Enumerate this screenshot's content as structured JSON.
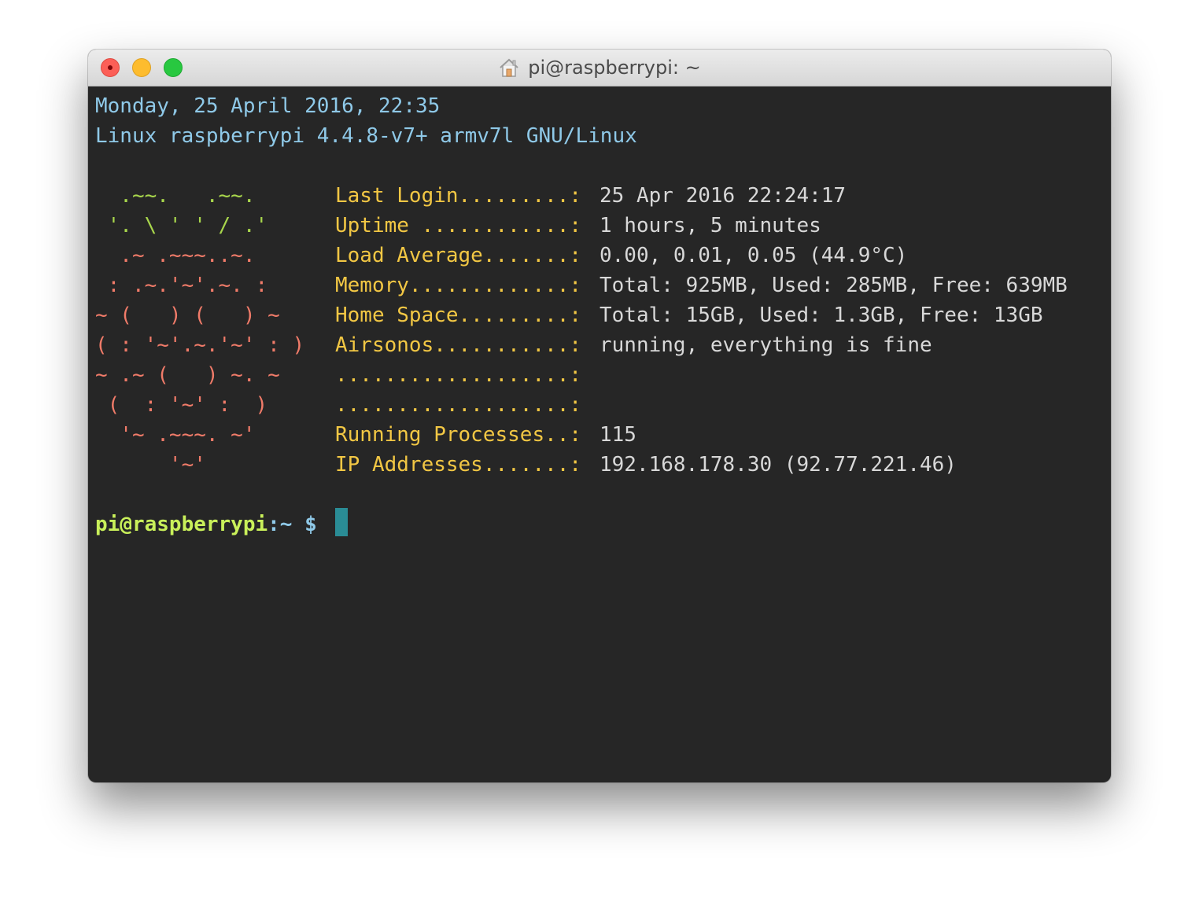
{
  "window": {
    "title": "pi@raspberrypi: ~",
    "title_icon": "home-icon",
    "traffic_lights": [
      "close",
      "minimize",
      "zoom"
    ]
  },
  "colors": {
    "background": "#262626",
    "header_blue": "#8fc9e8",
    "ascii_green": "#a8d64c",
    "ascii_red": "#f07b69",
    "label_yellow": "#f2c744",
    "value_grey": "#d8d8d8",
    "prompt_green": "#c9f05a",
    "cursor": "#2a8c95"
  },
  "header": {
    "date_line": "Monday, 25 April 2016, 22:35",
    "system_line": "Linux raspberrypi 4.4.8-v7+ armv7l GNU/Linux"
  },
  "logo": [
    "  .~~.   .~~.",
    " '. \\ ' ' / .'",
    "  .~ .~~~..~.",
    " : .~.'~'.~. :",
    "~ (   ) (   ) ~",
    "( : '~'.~.'~' : )",
    "~ .~ (   ) ~. ~",
    " (  : '~' :  )",
    "  '~ .~~~. ~'",
    "      '~'"
  ],
  "info": [
    {
      "label": "Last Login.........:",
      "value": "25 Apr 2016 22:24:17"
    },
    {
      "label": "Uptime ............:",
      "value": "1 hours, 5 minutes"
    },
    {
      "label": "Load Average.......:",
      "value": "0.00, 0.01, 0.05 (44.9°C)"
    },
    {
      "label": "Memory.............:",
      "value": "Total: 925MB, Used: 285MB, Free: 639MB"
    },
    {
      "label": "Home Space.........:",
      "value": "Total: 15GB, Used: 1.3GB, Free: 13GB"
    },
    {
      "label": "Airsonos...........:",
      "value": "running, everything is fine"
    },
    {
      "label": "...................:",
      "value": ""
    },
    {
      "label": "...................:",
      "value": ""
    },
    {
      "label": "Running Processes..:",
      "value": "115"
    },
    {
      "label": "IP Addresses.......:",
      "value": "192.168.178.30 (92.77.221.46)"
    }
  ],
  "prompt": {
    "user_host": "pi@raspberrypi",
    "path_symbol": ":~ $"
  }
}
